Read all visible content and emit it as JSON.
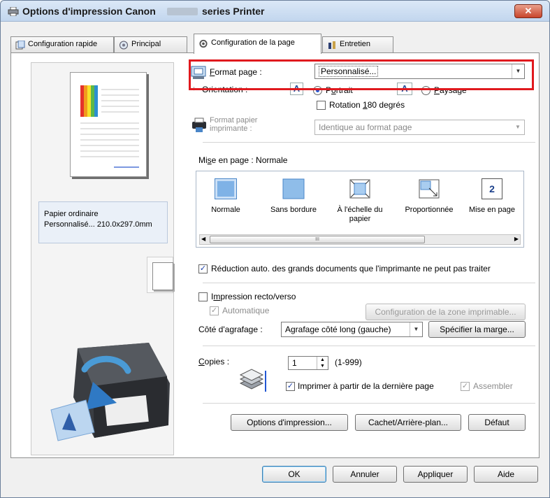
{
  "window": {
    "title": "Options d'impression Canon",
    "title_suffix": "series Printer",
    "close_label": "✕"
  },
  "tabs": [
    {
      "label": "Configuration rapide",
      "icon": "quick-setup-icon"
    },
    {
      "label": "Principal",
      "icon": "main-icon"
    },
    {
      "label": "Configuration de la page",
      "icon": "page-setup-icon"
    },
    {
      "label": "Entretien",
      "icon": "maintenance-icon"
    }
  ],
  "preview": {
    "paper_line1": "Papier ordinaire",
    "paper_line2": "Personnalisé... 210.0x297.0mm"
  },
  "page_size": {
    "label_u": "F",
    "label_rest": "ormat page :",
    "value": "Personnalisé..."
  },
  "orientation": {
    "label": "Orientation :",
    "portrait_pre": "P",
    "portrait_u": "o",
    "portrait_post": "rtrait",
    "landscape_u": "P",
    "landscape_rest": "aysage",
    "rotate_pre": "Rotation ",
    "rotate_u": "1",
    "rotate_post": "80 degrés"
  },
  "printer_paper": {
    "label_line1": "Format papier",
    "label_line2": "imprimante :",
    "value": "Identique au format page"
  },
  "layout": {
    "label_pre": "Mi",
    "label_u": "s",
    "label_post": "e en page : Normale",
    "items": [
      {
        "label": "Normale",
        "icon": "normal-layout-icon"
      },
      {
        "label": "Sans bordure",
        "icon": "borderless-icon"
      },
      {
        "label": "À l'échelle du papier",
        "icon": "fit-to-page-icon"
      },
      {
        "label": "Proportionnée",
        "icon": "scaled-icon"
      },
      {
        "label": "Mise en page",
        "icon": "page-layout-icon",
        "badge": "2"
      }
    ],
    "scroll_glyph": "III"
  },
  "auto_reduce": {
    "text": "Réduction auto. des grands documents que l'imprimante ne peut pas traiter"
  },
  "duplex": {
    "label_pre": "I",
    "label_u": "m",
    "label_post": "pression recto/verso",
    "auto": "Automatique",
    "print_area_button": "Configuration de la zone imprimable..."
  },
  "stapling": {
    "label": "Côté d'agrafage :",
    "value": "Agrafage côté long (gauche)",
    "margin_button": "Spécifier la marge..."
  },
  "copies": {
    "label_u": "C",
    "label_rest": "opies :",
    "value": "1",
    "range": "(1-999)",
    "last_page": "Imprimer à partir de la dernière page",
    "collate": "Assembler"
  },
  "buttons": {
    "print_options": "Options d'impression...",
    "stamp": "Cachet/Arrière-plan...",
    "defaults": "Défaut",
    "ok": "OK",
    "cancel": "Annuler",
    "apply": "Appliquer",
    "help": "Aide"
  },
  "colors": {
    "highlight": "#e0191e",
    "accent": "#2257d3"
  }
}
